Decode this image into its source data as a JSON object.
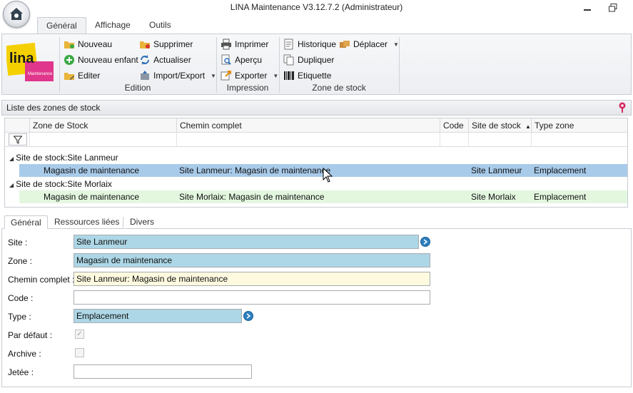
{
  "window": {
    "title": "LINA Maintenance  V3.12.7.2  (Administrateur)"
  },
  "ribbon": {
    "tabs": [
      "Général",
      "Affichage",
      "Outils"
    ],
    "active_tab": "Général",
    "logo": {
      "text": "lina",
      "subtext": "Maintenance"
    },
    "groups": {
      "edition": {
        "label": "Edition",
        "buttons": [
          "Nouveau",
          "Supprimer",
          "Nouveau enfant",
          "Actualiser",
          "Editer",
          "Import/Export"
        ]
      },
      "impression": {
        "label": "Impression",
        "buttons": [
          "Imprimer",
          "Aperçu",
          "Exporter"
        ]
      },
      "zone_de_stock": {
        "label": "Zone de stock",
        "buttons": [
          "Historique",
          "Déplacer",
          "Dupliquer",
          "Etiquette"
        ]
      }
    }
  },
  "list_panel": {
    "title": "Liste des zones de stock",
    "columns": [
      "Zone de Stock",
      "Chemin complet",
      "Code",
      "Site de stock",
      "Type zone"
    ],
    "sort_indicator": "▲",
    "groups": [
      {
        "label": "Site de stock:Site Lanmeur",
        "rows": [
          {
            "zone": "Magasin de maintenance",
            "chemin": "Site Lanmeur: Magasin de maintenance",
            "code": "",
            "site": "Site Lanmeur",
            "type": "Emplacement",
            "selected": true
          }
        ]
      },
      {
        "label": "Site de stock:Site Morlaix",
        "rows": [
          {
            "zone": "Magasin de maintenance",
            "chemin": "Site Morlaix: Magasin de maintenance",
            "code": "",
            "site": "Site Morlaix",
            "type": "Emplacement",
            "selected": false
          }
        ]
      }
    ]
  },
  "detail": {
    "tabs": [
      "Général",
      "Ressources liées",
      "Divers"
    ],
    "active_tab": "Général",
    "fields": {
      "site": {
        "label": "Site :",
        "value": "Site Lanmeur"
      },
      "zone": {
        "label": "Zone :",
        "value": "Magasin de maintenance"
      },
      "chemin": {
        "label": "Chemin complet :",
        "value": "Site Lanmeur: Magasin de maintenance"
      },
      "code": {
        "label": "Code :",
        "value": ""
      },
      "type": {
        "label": "Type :",
        "value": "Emplacement"
      },
      "par_defaut": {
        "label": "Par défaut :",
        "checked": true
      },
      "archive": {
        "label": "Archive :",
        "checked": false
      },
      "jetee": {
        "label": "Jetée :",
        "value": ""
      }
    }
  },
  "colors": {
    "selected_row": "#a9cbea",
    "alt_row": "#e3f7df",
    "field_blue": "#add7e6",
    "field_yellow": "#fefadf",
    "logo_yellow": "#f5d000",
    "logo_pink": "#e0368c"
  }
}
